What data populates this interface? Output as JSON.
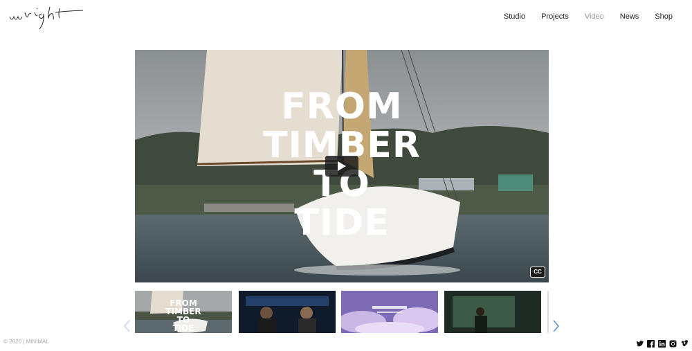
{
  "logo": {
    "text": "wright"
  },
  "nav": {
    "items": [
      {
        "label": "Studio",
        "active": false
      },
      {
        "label": "Projects",
        "active": false
      },
      {
        "label": "Video",
        "active": true
      },
      {
        "label": "News",
        "active": false
      },
      {
        "label": "Shop",
        "active": false
      }
    ]
  },
  "player": {
    "title_lines": [
      "FROM",
      "TIMBER",
      "TO",
      "TIDE"
    ],
    "play_icon": "play-icon",
    "cc_label": "CC"
  },
  "thumbnails": [
    {
      "title_lines": [
        "FROM",
        "TIMBER",
        "TO",
        "TIDE"
      ],
      "scene": "sailboat"
    },
    {
      "title_lines": [],
      "scene": "car-interior-night"
    },
    {
      "title_lines": [],
      "scene": "purple-clouds-title"
    },
    {
      "title_lines": [],
      "scene": "dark-green-room"
    }
  ],
  "carousel": {
    "prev_icon": "chevron-left-icon",
    "next_icon": "chevron-right-icon"
  },
  "footer": {
    "copyright": "© 2020 | MINIMAL",
    "social_icons": [
      "twitter-icon",
      "facebook-icon",
      "linkedin-icon",
      "instagram-icon",
      "vimeo-icon"
    ]
  },
  "colors": {
    "accent": "#5b8fd6",
    "nav_active": "#999999",
    "text": "#222222"
  }
}
